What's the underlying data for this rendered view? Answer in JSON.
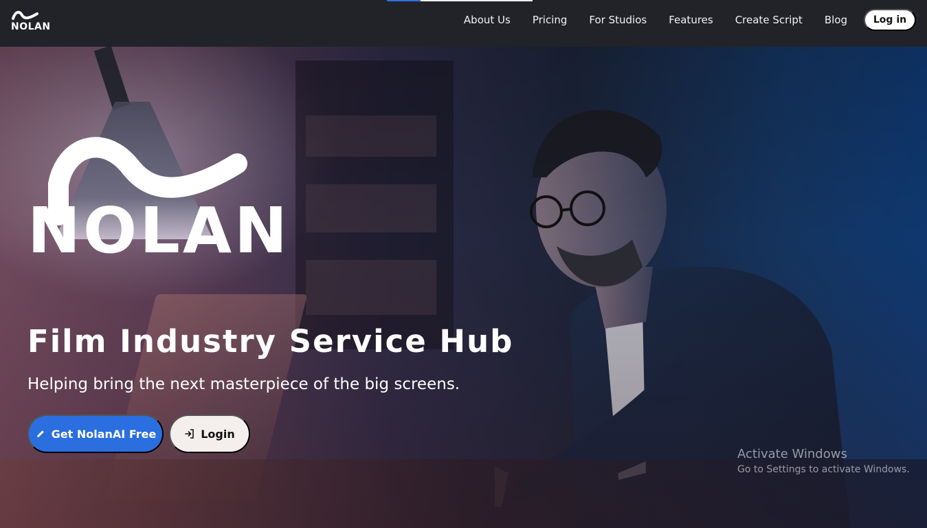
{
  "brand": {
    "name": "NOLAN"
  },
  "scroll_progress_percent": 23,
  "nav": {
    "items": [
      {
        "label": "About Us"
      },
      {
        "label": "Pricing"
      },
      {
        "label": "For Studios"
      },
      {
        "label": "Features"
      },
      {
        "label": "Create Script"
      },
      {
        "label": "Blog"
      }
    ],
    "login_label": "Log in"
  },
  "hero": {
    "logo_text": "NOLAN",
    "title": "Film Industry Service Hub",
    "subtitle": "Helping bring the next masterpiece of the big screens.",
    "primary_button": {
      "label": "Get NolanAI Free",
      "icon": "pencil-icon"
    },
    "secondary_button": {
      "label": "Login",
      "icon": "login-icon"
    }
  },
  "watermark": {
    "title": "Activate Windows",
    "subtitle": "Go to Settings to activate Windows."
  },
  "colors": {
    "topbar": "#212329",
    "primary": "#2a6ee0",
    "secondary_bg": "#f4efec",
    "progress": "#2d6fe0"
  }
}
